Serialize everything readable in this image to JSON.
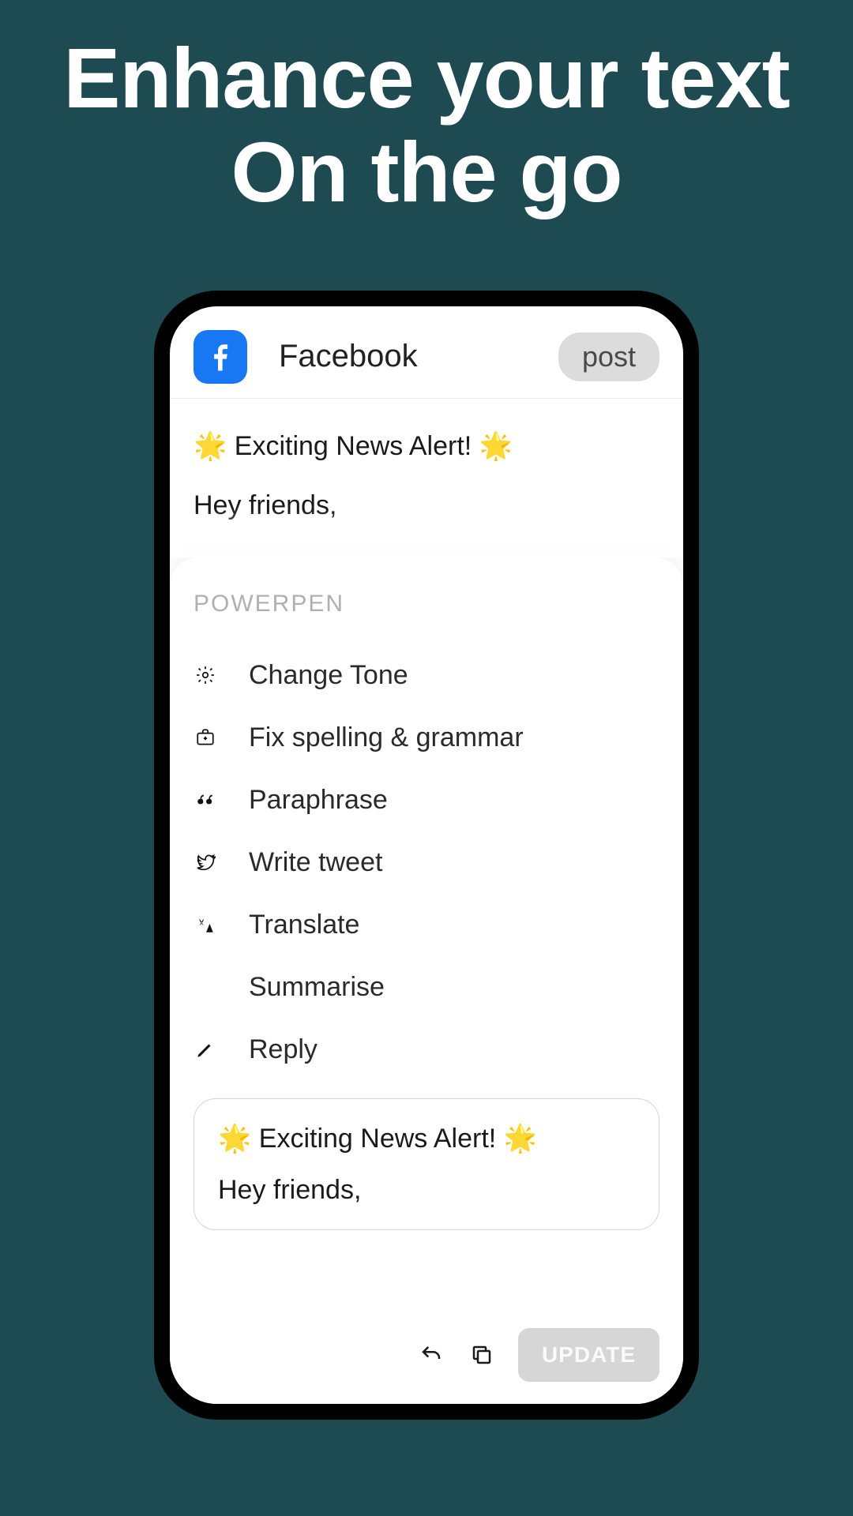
{
  "hero": {
    "line1": "Enhance your text",
    "line2": "On the go"
  },
  "header": {
    "app_name": "Facebook",
    "post_label": "post"
  },
  "content": {
    "line1": "🌟 Exciting News Alert! 🌟",
    "line2": "Hey friends,"
  },
  "sheet": {
    "title": "POWERPEN",
    "actions": [
      {
        "label": "Change Tone"
      },
      {
        "label": "Fix spelling & grammar"
      },
      {
        "label": "Paraphrase"
      },
      {
        "label": "Write tweet"
      },
      {
        "label": "Translate"
      },
      {
        "label": "Summarise"
      },
      {
        "label": "Reply"
      }
    ],
    "preview": {
      "line1": "🌟 Exciting News Alert! 🌟",
      "line2": "Hey friends,"
    },
    "update_label": "UPDATE"
  }
}
